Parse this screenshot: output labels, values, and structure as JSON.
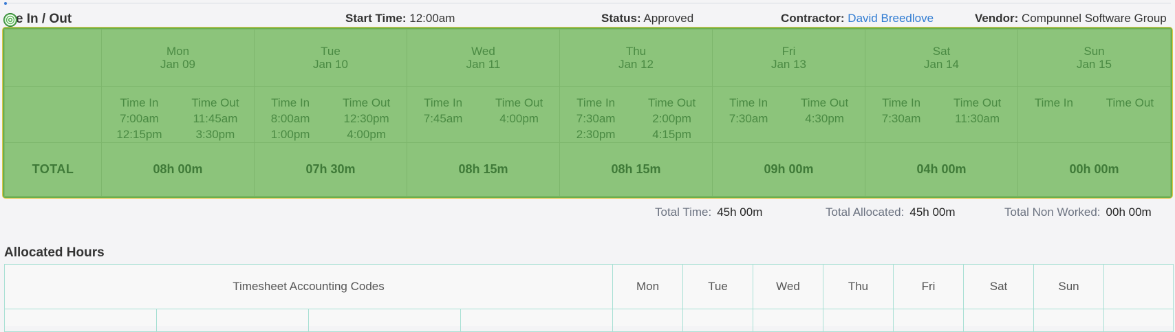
{
  "header": {
    "title": "me In / Out",
    "start_time_label": "Start Time:",
    "start_time_value": "12:00am",
    "status_label": "Status:",
    "status_value": "Approved",
    "contractor_label": "Contractor:",
    "contractor_value": "David Breedlove",
    "vendor_label": "Vendor:",
    "vendor_value": "Compunnel Software Group"
  },
  "week": {
    "time_in_label": "Time In",
    "time_out_label": "Time Out",
    "total_label": "TOTAL",
    "days": [
      {
        "day": "Mon",
        "date": "Jan 09",
        "in": [
          "7:00am",
          "12:15pm"
        ],
        "out": [
          "11:45am",
          "3:30pm"
        ],
        "total": "08h 00m"
      },
      {
        "day": "Tue",
        "date": "Jan 10",
        "in": [
          "8:00am",
          "1:00pm"
        ],
        "out": [
          "12:30pm",
          "4:00pm"
        ],
        "total": "07h 30m"
      },
      {
        "day": "Wed",
        "date": "Jan 11",
        "in": [
          "7:45am"
        ],
        "out": [
          "4:00pm"
        ],
        "total": "08h 15m"
      },
      {
        "day": "Thu",
        "date": "Jan 12",
        "in": [
          "7:30am",
          "2:30pm"
        ],
        "out": [
          "2:00pm",
          "4:15pm"
        ],
        "total": "08h 15m"
      },
      {
        "day": "Fri",
        "date": "Jan 13",
        "in": [
          "7:30am"
        ],
        "out": [
          "4:30pm"
        ],
        "total": "09h 00m"
      },
      {
        "day": "Sat",
        "date": "Jan 14",
        "in": [
          "7:30am"
        ],
        "out": [
          "11:30am"
        ],
        "total": "04h 00m"
      },
      {
        "day": "Sun",
        "date": "Jan 15",
        "in": [],
        "out": [],
        "total": "00h 00m"
      }
    ]
  },
  "summary": {
    "total_time_label": "Total Time:",
    "total_time_value": "45h 00m",
    "total_allocated_label": "Total Allocated:",
    "total_allocated_value": "45h 00m",
    "total_non_worked_label": "Total Non Worked:",
    "total_non_worked_value": "00h 00m"
  },
  "allocated": {
    "title": "Allocated Hours",
    "codes_header": "Timesheet Accounting Codes",
    "day_headers": [
      "Mon",
      "Tue",
      "Wed",
      "Thu",
      "Fri",
      "Sat",
      "Sun"
    ]
  },
  "icons": {
    "overlay_target": "target-icon"
  }
}
